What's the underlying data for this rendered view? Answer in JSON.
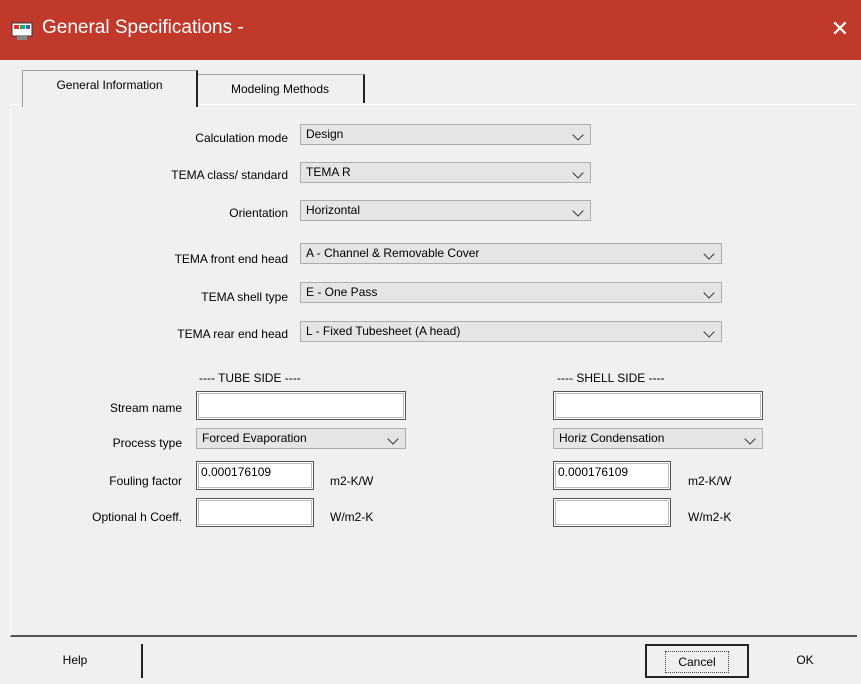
{
  "window": {
    "title": "General Specifications -",
    "close_label": "✕"
  },
  "tabs": [
    {
      "label": "General Information",
      "active": true
    },
    {
      "label": "Modeling Methods",
      "active": false
    }
  ],
  "form": {
    "calculation_mode": {
      "label": "Calculation mode",
      "value": "Design"
    },
    "tema_class": {
      "label": "TEMA class/ standard",
      "value": "TEMA R"
    },
    "orientation": {
      "label": "Orientation",
      "value": "Horizontal"
    },
    "front_head": {
      "label": "TEMA front end head",
      "value": "A - Channel & Removable Cover"
    },
    "shell_type": {
      "label": "TEMA shell type",
      "value": "E - One Pass"
    },
    "rear_head": {
      "label": "TEMA rear end head",
      "value": "L - Fixed Tubesheet (A head)"
    }
  },
  "rows": {
    "stream_name": "Stream name",
    "process_type": "Process type",
    "fouling_factor": "Fouling factor",
    "optional_h": "Optional h Coeff."
  },
  "tube_side": {
    "heading": "---- TUBE SIDE ----",
    "stream_name": "",
    "process_type": "Forced Evaporation",
    "fouling_factor": "0.000176109",
    "fouling_unit": "m2-K/W",
    "h_coeff": "",
    "h_unit": "W/m2-K"
  },
  "shell_side": {
    "heading": "---- SHELL SIDE ----",
    "stream_name": "",
    "process_type": "Horiz Condensation",
    "fouling_factor": "0.000176109",
    "fouling_unit": "m2-K/W",
    "h_coeff": "",
    "h_unit": "W/m2-K"
  },
  "buttons": {
    "help": "Help",
    "cancel": "Cancel",
    "ok": "OK"
  }
}
